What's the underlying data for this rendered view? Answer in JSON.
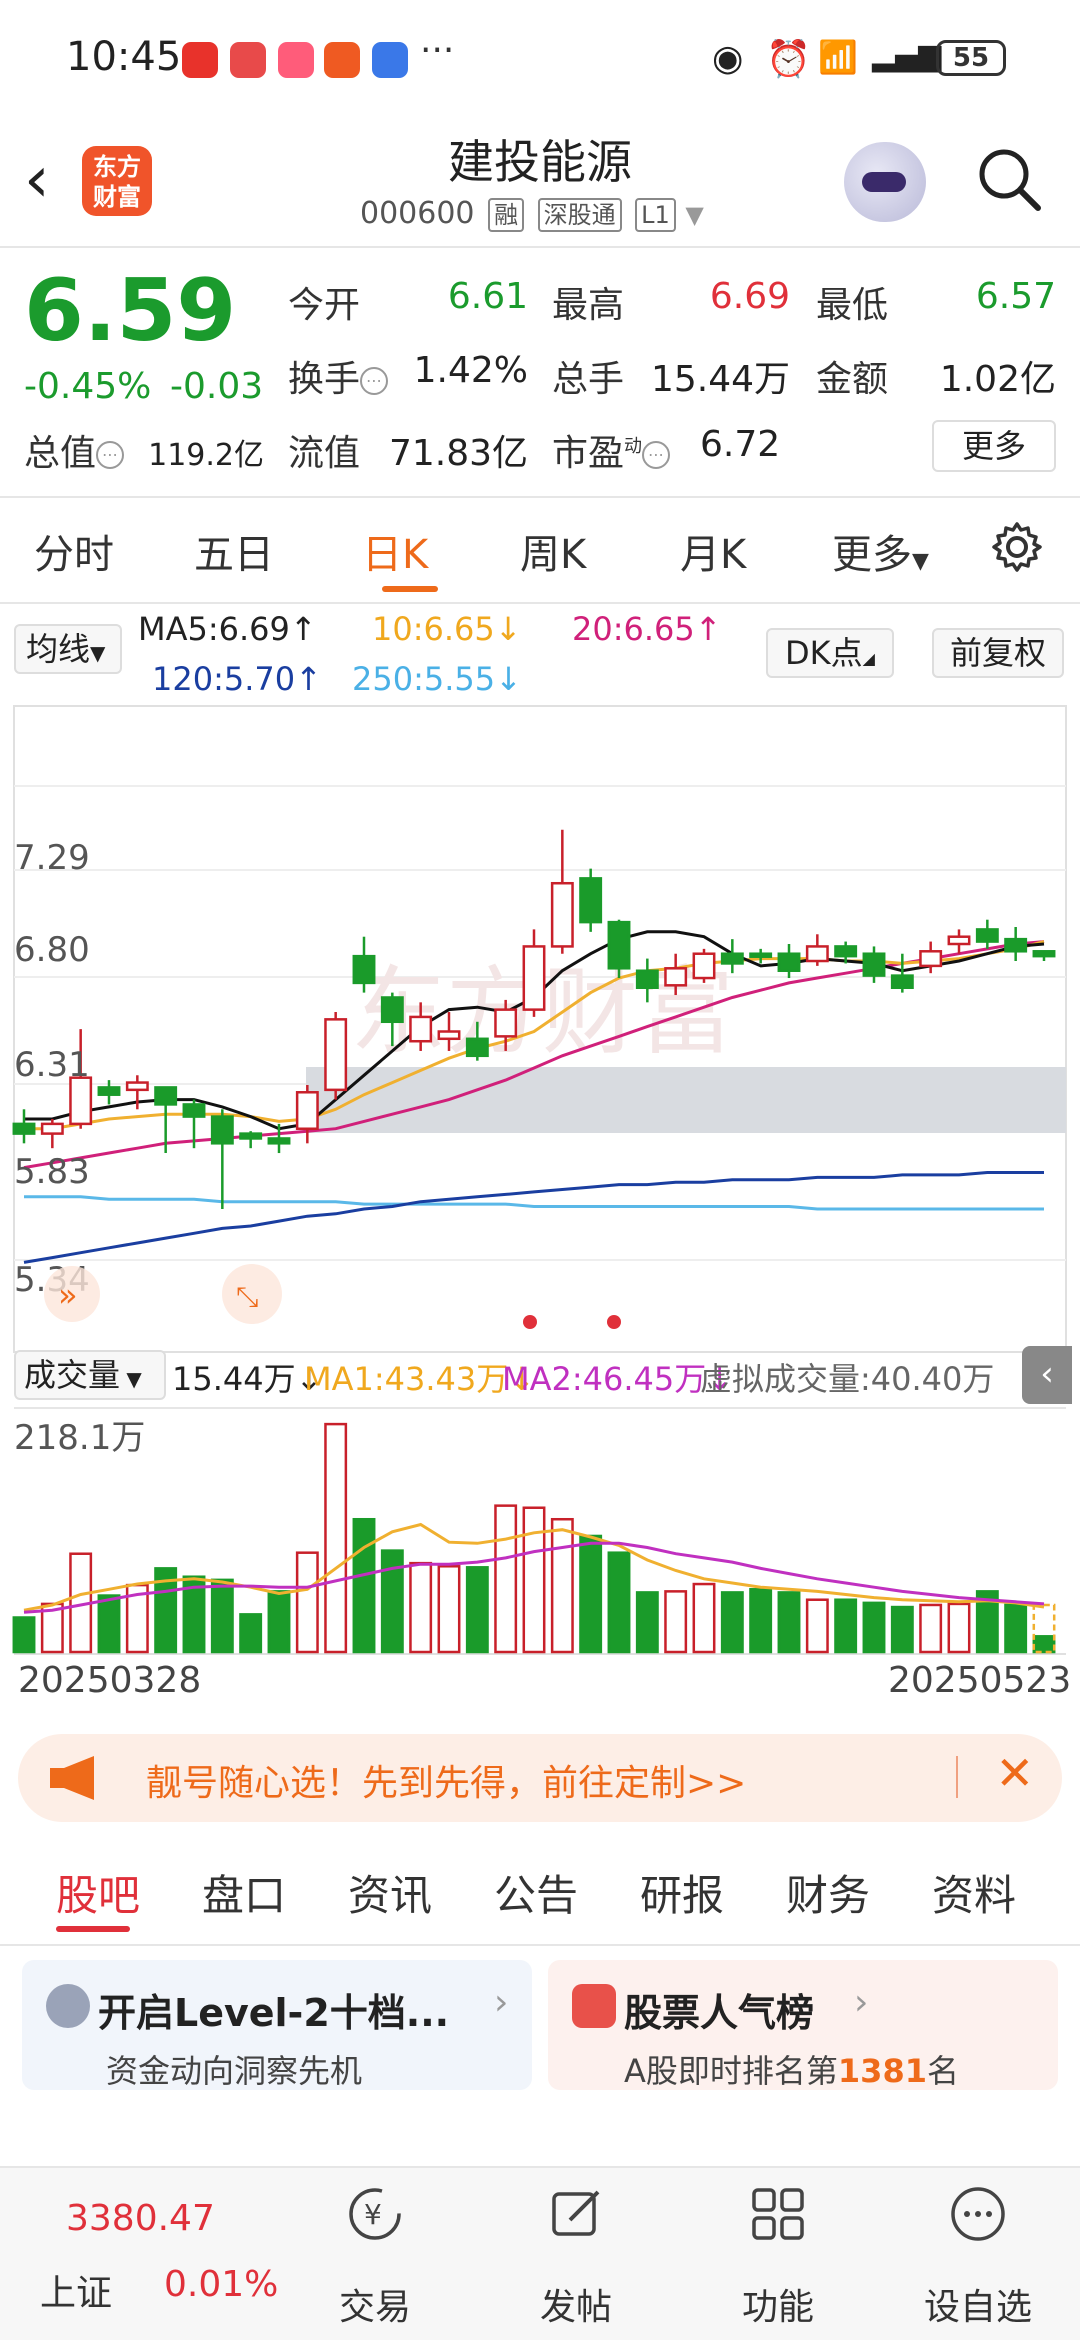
{
  "status_bar": {
    "time": "10:45",
    "battery": "55",
    "more": "···"
  },
  "header": {
    "logo_line1": "东方",
    "logo_line2": "财富",
    "name": "建投能源",
    "code": "000600",
    "tags": [
      "融",
      "深股通",
      "L1"
    ]
  },
  "quote": {
    "price": "6.59",
    "change_pct": "-0.45%",
    "change": "-0.03",
    "fields": [
      {
        "label": "今开",
        "value": "6.61",
        "color": "green"
      },
      {
        "label": "最高",
        "value": "6.69",
        "color": "red"
      },
      {
        "label": "最低",
        "value": "6.57",
        "color": "green"
      },
      {
        "label": "换手",
        "value": "1.42%",
        "color": "black"
      },
      {
        "label": "总手",
        "value": "15.44万",
        "color": "black"
      },
      {
        "label": "金额",
        "value": "1.02亿",
        "color": "black"
      },
      {
        "label": "总值",
        "value": "119.2亿",
        "color": "black"
      },
      {
        "label": "流值",
        "value": "71.83亿",
        "color": "black"
      },
      {
        "label": "市盈",
        "value": "6.72",
        "color": "black"
      }
    ],
    "pe_superscript": "动",
    "more_label": "更多"
  },
  "kline_tabs": [
    "分时",
    "五日",
    "日K",
    "周K",
    "月K",
    "更多"
  ],
  "active_kline_tab": "日K",
  "ma_bar": {
    "selector": "均线",
    "ma5": "MA5:6.69↑",
    "ma10": "10:6.65↓",
    "ma20": "20:6.65↑",
    "ma120": "120:5.70↑",
    "ma250": "250:5.55↓",
    "dk_label": "DK点",
    "adjust_label": "前复权"
  },
  "price_axis": [
    "7.29",
    "6.80",
    "6.31",
    "5.83",
    "5.34"
  ],
  "volume_bar": {
    "selector": "成交量",
    "vol": "15.44万↓",
    "ma1": "MA1:43.43万↓",
    "ma2": "MA2:46.45万↓",
    "virtual": "虚拟成交量:40.40万",
    "axis_max": "218.1万"
  },
  "dates": {
    "start": "20250328",
    "end": "20250523"
  },
  "banner": {
    "text": "靓号随心选！先到先得，前往定制>>"
  },
  "news_tabs": [
    "股吧",
    "盘口",
    "资讯",
    "公告",
    "研报",
    "财务",
    "资料"
  ],
  "cards": [
    {
      "title": "开启Level-2十档...",
      "subtitle": "资金动向洞察先机"
    },
    {
      "title": "股票人气榜",
      "subtitle_prefix": "A股即时排名第",
      "rank": "1381",
      "subtitle_suffix": "名"
    }
  ],
  "bottom_nav": {
    "index_value": "3380.47",
    "index_name": "上证",
    "index_change": "0.01%",
    "items": [
      "交易",
      "发帖",
      "功能",
      "设自选"
    ]
  },
  "chart_data": {
    "type": "candlestick",
    "dates": [
      "20250328",
      "20250523"
    ],
    "ylim": [
      5.34,
      7.29
    ],
    "candles": [
      {
        "o": 5.9,
        "c": 5.86,
        "h": 5.96,
        "l": 5.82
      },
      {
        "o": 5.86,
        "c": 5.9,
        "h": 5.92,
        "l": 5.8
      },
      {
        "o": 5.9,
        "c": 6.09,
        "h": 6.29,
        "l": 5.88
      },
      {
        "o": 6.05,
        "c": 6.02,
        "h": 6.08,
        "l": 5.98
      },
      {
        "o": 6.04,
        "c": 6.07,
        "h": 6.1,
        "l": 5.96
      },
      {
        "o": 6.05,
        "c": 5.98,
        "h": 6.05,
        "l": 5.78
      },
      {
        "o": 5.98,
        "c": 5.93,
        "h": 6.0,
        "l": 5.8
      },
      {
        "o": 5.93,
        "c": 5.82,
        "h": 5.96,
        "l": 5.55
      },
      {
        "o": 5.86,
        "c": 5.84,
        "h": 5.87,
        "l": 5.8
      },
      {
        "o": 5.84,
        "c": 5.82,
        "h": 5.9,
        "l": 5.78
      },
      {
        "o": 5.88,
        "c": 6.03,
        "h": 6.06,
        "l": 5.82
      },
      {
        "o": 6.04,
        "c": 6.33,
        "h": 6.36,
        "l": 6.0
      },
      {
        "o": 6.59,
        "c": 6.48,
        "h": 6.67,
        "l": 6.44
      },
      {
        "o": 6.42,
        "c": 6.32,
        "h": 6.44,
        "l": 6.22
      },
      {
        "o": 6.24,
        "c": 6.34,
        "h": 6.4,
        "l": 6.2
      },
      {
        "o": 6.25,
        "c": 6.28,
        "h": 6.36,
        "l": 6.2
      },
      {
        "o": 6.25,
        "c": 6.18,
        "h": 6.32,
        "l": 6.16
      },
      {
        "o": 6.26,
        "c": 6.37,
        "h": 6.41,
        "l": 6.2
      },
      {
        "o": 6.37,
        "c": 6.63,
        "h": 6.7,
        "l": 6.34
      },
      {
        "o": 6.63,
        "c": 6.89,
        "h": 7.11,
        "l": 6.6
      },
      {
        "o": 6.91,
        "c": 6.73,
        "h": 6.95,
        "l": 6.69
      },
      {
        "o": 6.73,
        "c": 6.54,
        "h": 6.74,
        "l": 6.5
      },
      {
        "o": 6.53,
        "c": 6.46,
        "h": 6.58,
        "l": 6.4
      },
      {
        "o": 6.47,
        "c": 6.54,
        "h": 6.6,
        "l": 6.43
      },
      {
        "o": 6.5,
        "c": 6.6,
        "h": 6.62,
        "l": 6.48
      },
      {
        "o": 6.6,
        "c": 6.56,
        "h": 6.66,
        "l": 6.52
      },
      {
        "o": 6.6,
        "c": 6.59,
        "h": 6.62,
        "l": 6.56
      },
      {
        "o": 6.6,
        "c": 6.53,
        "h": 6.64,
        "l": 6.5
      },
      {
        "o": 6.57,
        "c": 6.63,
        "h": 6.68,
        "l": 6.55
      },
      {
        "o": 6.63,
        "c": 6.59,
        "h": 6.65,
        "l": 6.56
      },
      {
        "o": 6.6,
        "c": 6.51,
        "h": 6.63,
        "l": 6.48
      },
      {
        "o": 6.51,
        "c": 6.46,
        "h": 6.6,
        "l": 6.44
      },
      {
        "o": 6.55,
        "c": 6.61,
        "h": 6.65,
        "l": 6.52
      },
      {
        "o": 6.64,
        "c": 6.67,
        "h": 6.7,
        "l": 6.6
      },
      {
        "o": 6.7,
        "c": 6.65,
        "h": 6.74,
        "l": 6.62
      },
      {
        "o": 6.66,
        "c": 6.61,
        "h": 6.71,
        "l": 6.57
      },
      {
        "o": 6.61,
        "c": 6.59,
        "h": 6.6,
        "l": 6.57
      }
    ],
    "ma5": [
      5.92,
      5.92,
      5.95,
      5.97,
      5.99,
      6.0,
      6.0,
      5.97,
      5.93,
      5.88,
      5.9,
      6.0,
      6.1,
      6.2,
      6.3,
      6.37,
      6.38,
      6.36,
      6.42,
      6.53,
      6.6,
      6.66,
      6.69,
      6.69,
      6.67,
      6.6,
      6.55,
      6.56,
      6.58,
      6.57,
      6.56,
      6.53,
      6.55,
      6.57,
      6.6,
      6.63,
      6.64
    ],
    "ma10": [
      5.88,
      5.88,
      5.9,
      5.92,
      5.93,
      5.94,
      5.94,
      5.94,
      5.93,
      5.91,
      5.92,
      5.96,
      6.02,
      6.07,
      6.12,
      6.17,
      6.21,
      6.24,
      6.28,
      6.36,
      6.44,
      6.5,
      6.53,
      6.54,
      6.56,
      6.57,
      6.58,
      6.58,
      6.58,
      6.57,
      6.57,
      6.56,
      6.57,
      6.58,
      6.6,
      6.62,
      6.65
    ],
    "ma20": [
      5.72,
      5.74,
      5.76,
      5.78,
      5.8,
      5.82,
      5.83,
      5.84,
      5.85,
      5.86,
      5.87,
      5.88,
      5.91,
      5.94,
      5.97,
      6.0,
      6.04,
      6.08,
      6.13,
      6.18,
      6.22,
      6.26,
      6.3,
      6.34,
      6.38,
      6.42,
      6.45,
      6.48,
      6.5,
      6.52,
      6.54,
      6.56,
      6.58,
      6.6,
      6.62,
      6.64,
      6.65
    ],
    "ma120": [
      5.33,
      5.35,
      5.37,
      5.39,
      5.41,
      5.43,
      5.45,
      5.47,
      5.48,
      5.5,
      5.52,
      5.53,
      5.55,
      5.56,
      5.58,
      5.59,
      5.6,
      5.61,
      5.62,
      5.63,
      5.64,
      5.65,
      5.65,
      5.66,
      5.66,
      5.67,
      5.67,
      5.67,
      5.68,
      5.68,
      5.68,
      5.69,
      5.69,
      5.69,
      5.7,
      5.7,
      5.7
    ],
    "ma250": [
      5.6,
      5.6,
      5.6,
      5.59,
      5.59,
      5.59,
      5.59,
      5.58,
      5.58,
      5.58,
      5.58,
      5.58,
      5.57,
      5.57,
      5.57,
      5.57,
      5.57,
      5.57,
      5.56,
      5.56,
      5.56,
      5.56,
      5.56,
      5.56,
      5.56,
      5.56,
      5.56,
      5.56,
      5.55,
      5.55,
      5.55,
      5.55,
      5.55,
      5.55,
      5.55,
      5.55,
      5.55
    ],
    "volume_max": 218.1,
    "volume": [
      33,
      46,
      94,
      54,
      64,
      80,
      72,
      69,
      36,
      58,
      95,
      218,
      127,
      97,
      85,
      82,
      81,
      140,
      138,
      127,
      111,
      95,
      57,
      58,
      65,
      57,
      60,
      57,
      50,
      50,
      47,
      43,
      45,
      46,
      58,
      45,
      15
    ],
    "volume_ma1": [
      40,
      45,
      55,
      60,
      65,
      68,
      70,
      67,
      62,
      56,
      60,
      80,
      100,
      115,
      122,
      105,
      104,
      108,
      114,
      117,
      110,
      102,
      88,
      78,
      70,
      66,
      62,
      60,
      58,
      55,
      52,
      50,
      49,
      48,
      49,
      47,
      43
    ],
    "volume_ma2": [
      38,
      40,
      45,
      50,
      55,
      58,
      62,
      63,
      63,
      62,
      62,
      68,
      74,
      80,
      84,
      84,
      86,
      90,
      96,
      100,
      104,
      104,
      100,
      94,
      90,
      86,
      80,
      75,
      70,
      66,
      62,
      58,
      55,
      52,
      50,
      48,
      46
    ]
  }
}
